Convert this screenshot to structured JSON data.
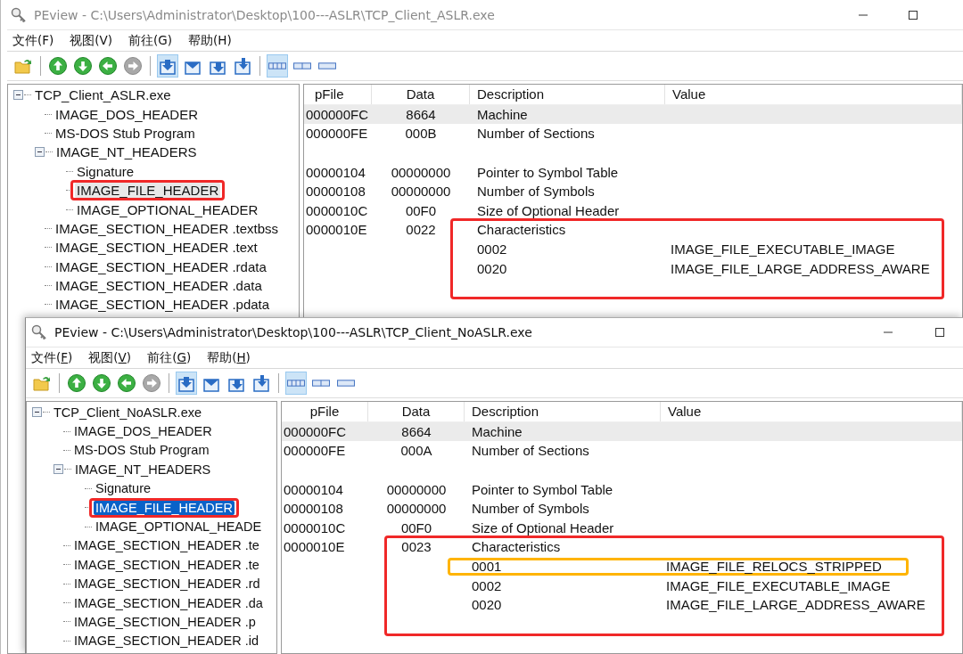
{
  "windows": [
    {
      "title": "PEview - C:\\Users\\Administrator\\Desktop\\100---ASLR\\TCP_Client_ASLR.exe",
      "active": false,
      "accelerators_shown": false,
      "menu": [
        "文件(F)",
        "视图(V)",
        "前往(G)",
        "帮助(H)"
      ],
      "toolbar": [
        {
          "kind": "folder"
        },
        {
          "kind": "separator"
        },
        {
          "kind": "nav",
          "disabled": false
        },
        {
          "kind": "nav",
          "disabled": false
        },
        {
          "kind": "nav",
          "disabled": false
        },
        {
          "kind": "nav",
          "disabled": true
        },
        {
          "kind": "separator"
        },
        {
          "kind": "doc",
          "pressed": true
        },
        {
          "kind": "doc",
          "pressed": false
        },
        {
          "kind": "doc",
          "pressed": false
        },
        {
          "kind": "doc",
          "pressed": false
        },
        {
          "kind": "separator"
        },
        {
          "kind": "view",
          "pressed": true
        },
        {
          "kind": "view",
          "pressed": false
        },
        {
          "kind": "view",
          "pressed": false
        }
      ],
      "tree": [
        {
          "label": "TCP_Client_ASLR.exe",
          "selected": false,
          "expanded": true,
          "children": [
            {
              "label": "IMAGE_DOS_HEADER",
              "selected": false
            },
            {
              "label": "MS-DOS Stub Program",
              "selected": false
            },
            {
              "label": "IMAGE_NT_HEADERS",
              "selected": false,
              "expanded": true,
              "children": [
                {
                  "label": "Signature",
                  "selected": false
                },
                {
                  "label": "IMAGE_FILE_HEADER",
                  "selected": true,
                  "color": "#f02828"
                },
                {
                  "label": "IMAGE_OPTIONAL_HEADER",
                  "selected": false
                }
              ]
            },
            {
              "label": "IMAGE_SECTION_HEADER .textbss",
              "selected": false
            },
            {
              "label": "IMAGE_SECTION_HEADER .text",
              "selected": false
            },
            {
              "label": "IMAGE_SECTION_HEADER .rdata",
              "selected": false
            },
            {
              "label": "IMAGE_SECTION_HEADER .data",
              "selected": false
            },
            {
              "label": "IMAGE_SECTION_HEADER .pdata",
              "selected": false
            }
          ]
        }
      ],
      "columns": [
        "pFile",
        "Data",
        "Description",
        "Value"
      ],
      "rows": [
        {
          "kind": "field",
          "pfile": "000000FC",
          "data": "8664",
          "description": "Machine",
          "selected": true
        },
        {
          "kind": "field",
          "pfile": "000000FE",
          "data": "000B",
          "description": "Number of Sections",
          "selected": false
        },
        {
          "kind": "blank"
        },
        {
          "kind": "field",
          "pfile": "00000104",
          "data": "00000000",
          "description": "Pointer to Symbol Table",
          "selected": false
        },
        {
          "kind": "field",
          "pfile": "00000108",
          "data": "00000000",
          "description": "Number of Symbols",
          "selected": false
        },
        {
          "kind": "field",
          "pfile": "0000010C",
          "data": "00F0",
          "description": "Size of Optional Header",
          "selected": false
        },
        {
          "kind": "field",
          "pfile": "0000010E",
          "data": "0022",
          "description": "Characteristics",
          "selected": false,
          "color": "#f02828",
          "flags": [
            {
              "bit": "0002",
              "value": "IMAGE_FILE_EXECUTABLE_IMAGE",
              "selected": false
            },
            {
              "bit": "0020",
              "value": "IMAGE_FILE_LARGE_ADDRESS_AWARE",
              "selected": false
            }
          ]
        }
      ]
    },
    {
      "title": "PEview - C:\\Users\\Administrator\\Desktop\\100---ASLR\\TCP_Client_NoASLR.exe",
      "active": true,
      "accelerators_shown": true,
      "menu": [
        "文件(F)",
        "视图(V)",
        "前往(G)",
        "帮助(H)"
      ],
      "toolbar": [
        {
          "kind": "folder"
        },
        {
          "kind": "separator"
        },
        {
          "kind": "nav",
          "disabled": false
        },
        {
          "kind": "nav",
          "disabled": false
        },
        {
          "kind": "nav",
          "disabled": false
        },
        {
          "kind": "nav",
          "disabled": true
        },
        {
          "kind": "separator"
        },
        {
          "kind": "doc",
          "pressed": true
        },
        {
          "kind": "doc",
          "pressed": false
        },
        {
          "kind": "doc",
          "pressed": false
        },
        {
          "kind": "doc",
          "pressed": false
        },
        {
          "kind": "separator"
        },
        {
          "kind": "view",
          "pressed": true
        },
        {
          "kind": "view",
          "pressed": false
        },
        {
          "kind": "view",
          "pressed": false
        }
      ],
      "tree": [
        {
          "label": "TCP_Client_NoASLR.exe",
          "selected": false,
          "expanded": true,
          "children": [
            {
              "label": "IMAGE_DOS_HEADER",
              "selected": false
            },
            {
              "label": "MS-DOS Stub Program",
              "selected": false
            },
            {
              "label": "IMAGE_NT_HEADERS",
              "selected": false,
              "expanded": true,
              "children": [
                {
                  "label": "Signature",
                  "selected": false
                },
                {
                  "label": "IMAGE_FILE_HEADER",
                  "selected": true,
                  "color": "#f02828"
                },
                {
                  "label": "IMAGE_OPTIONAL_HEADE",
                  "selected": false
                }
              ]
            },
            {
              "label": "IMAGE_SECTION_HEADER .te",
              "selected": false
            },
            {
              "label": "IMAGE_SECTION_HEADER .te",
              "selected": false
            },
            {
              "label": "IMAGE_SECTION_HEADER .rd",
              "selected": false
            },
            {
              "label": "IMAGE_SECTION_HEADER .da",
              "selected": false
            },
            {
              "label": "IMAGE_SECTION_HEADER .p",
              "selected": false
            },
            {
              "label": "IMAGE_SECTION_HEADER .id",
              "selected": false
            }
          ]
        }
      ],
      "columns": [
        "pFile",
        "Data",
        "Description",
        "Value"
      ],
      "rows": [
        {
          "kind": "field",
          "pfile": "000000FC",
          "data": "8664",
          "description": "Machine",
          "selected": true
        },
        {
          "kind": "field",
          "pfile": "000000FE",
          "data": "000A",
          "description": "Number of Sections",
          "selected": false
        },
        {
          "kind": "blank"
        },
        {
          "kind": "field",
          "pfile": "00000104",
          "data": "00000000",
          "description": "Pointer to Symbol Table",
          "selected": false
        },
        {
          "kind": "field",
          "pfile": "00000108",
          "data": "00000000",
          "description": "Number of Symbols",
          "selected": false
        },
        {
          "kind": "field",
          "pfile": "0000010C",
          "data": "00F0",
          "description": "Size of Optional Header",
          "selected": false
        },
        {
          "kind": "field",
          "pfile": "0000010E",
          "data": "0023",
          "description": "Characteristics",
          "selected": false,
          "color": "#f02828",
          "flags": [
            {
              "bit": "0001",
              "value": "IMAGE_FILE_RELOCS_STRIPPED",
              "selected": false,
              "color": "#ffb400"
            },
            {
              "bit": "0002",
              "value": "IMAGE_FILE_EXECUTABLE_IMAGE",
              "selected": false
            },
            {
              "bit": "0020",
              "value": "IMAGE_FILE_LARGE_ADDRESS_AWARE",
              "selected": false
            }
          ]
        }
      ]
    }
  ]
}
